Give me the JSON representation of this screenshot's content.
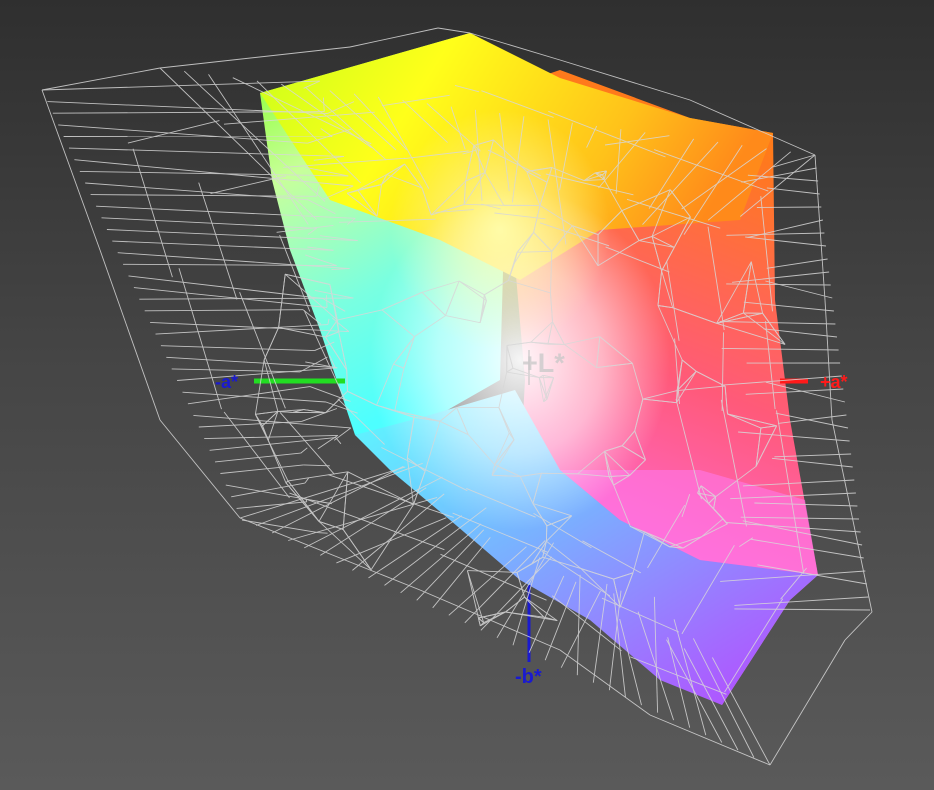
{
  "axes": {
    "l_plus": "+L*",
    "a_plus": "+a*",
    "a_minus": "-a*",
    "b_minus": "-b*"
  },
  "colors": {
    "background": "#3e3e3e",
    "wireframe": "#d8d8d8",
    "a_plus_axis": "#ff1a1a",
    "a_minus_axis": "#22dd22",
    "b_minus_axis": "#1a1ad0",
    "l_axis_label": "#c8c8c8"
  }
}
